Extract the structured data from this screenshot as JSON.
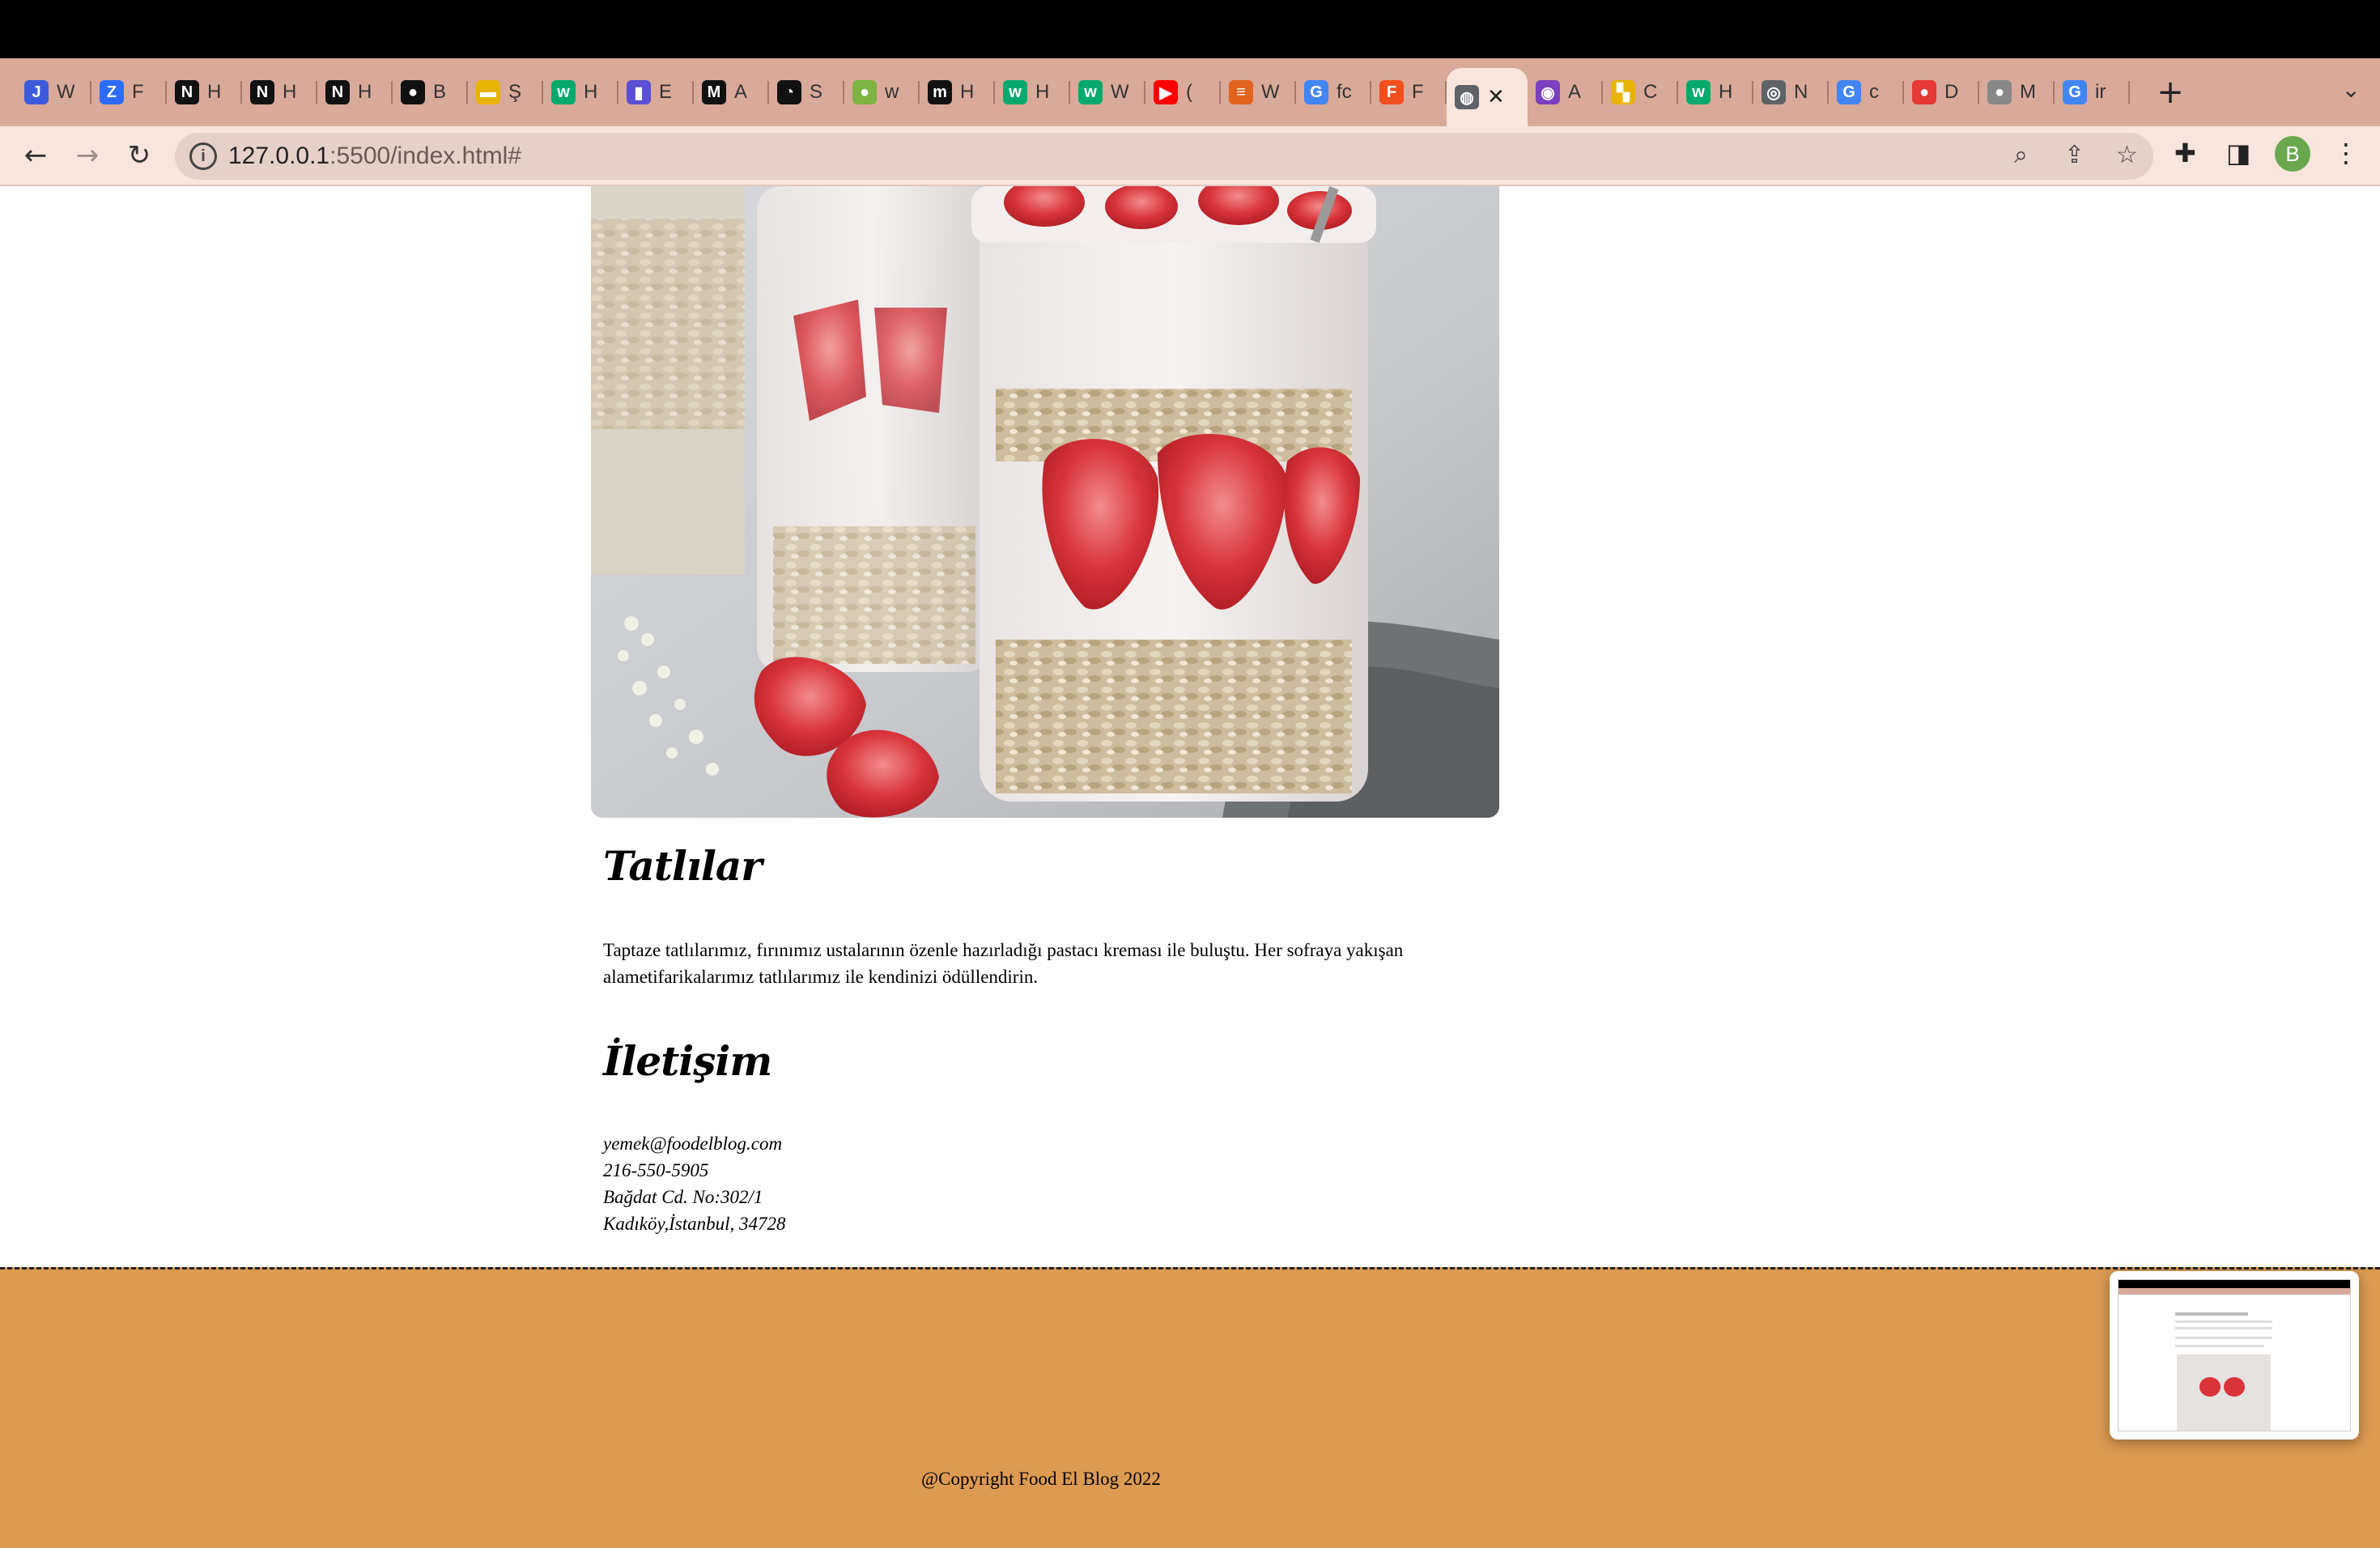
{
  "browser": {
    "tabs": [
      {
        "label": "W",
        "icon": "j-square-icon",
        "color": "#3b5bdb",
        "glyph": "J"
      },
      {
        "label": "F",
        "icon": "zoom-icon",
        "color": "#2d6bff",
        "glyph": "Z"
      },
      {
        "label": "H",
        "icon": "notion-icon",
        "color": "#111111",
        "glyph": "N"
      },
      {
        "label": "H",
        "icon": "notion-icon",
        "color": "#111111",
        "glyph": "N"
      },
      {
        "label": "H",
        "icon": "notion-icon",
        "color": "#111111",
        "glyph": "N"
      },
      {
        "label": "B",
        "icon": "github-icon",
        "color": "#111111",
        "glyph": "●"
      },
      {
        "label": "Ş",
        "icon": "ticket-icon",
        "color": "#e8b400",
        "glyph": "▬"
      },
      {
        "label": "H",
        "icon": "w3schools-icon",
        "color": "#04aa6d",
        "glyph": "w"
      },
      {
        "label": "E",
        "icon": "bookmark-icon",
        "color": "#5b4fd6",
        "glyph": "▮"
      },
      {
        "label": "A",
        "icon": "medium-icon",
        "color": "#111111",
        "glyph": "M"
      },
      {
        "label": "S",
        "icon": "speedometer-icon",
        "color": "#111111",
        "glyph": "◔"
      },
      {
        "label": "w",
        "icon": "droplet-icon",
        "color": "#7cb342",
        "glyph": "●"
      },
      {
        "label": "H",
        "icon": "m-icon",
        "color": "#111111",
        "glyph": "m"
      },
      {
        "label": "H",
        "icon": "w3schools-icon",
        "color": "#04aa6d",
        "glyph": "w"
      },
      {
        "label": "W",
        "icon": "w3schools-icon",
        "color": "#04aa6d",
        "glyph": "w"
      },
      {
        "label": "(",
        "icon": "youtube-icon",
        "color": "#ff0000",
        "glyph": "▶"
      },
      {
        "label": "W",
        "icon": "burger-icon",
        "color": "#e2631b",
        "glyph": "≡"
      },
      {
        "label": "fc",
        "icon": "google-icon",
        "color": "#4285f4",
        "glyph": "G"
      },
      {
        "label": "F",
        "icon": "figma-icon",
        "color": "#f24e1e",
        "glyph": "F"
      },
      {
        "label": "",
        "icon": "globe-icon",
        "color": "#5f6368",
        "glyph": "◍",
        "active": true
      },
      {
        "label": "A",
        "icon": "color-wheel-icon",
        "color": "#7b3fbf",
        "glyph": "◉"
      },
      {
        "label": "C",
        "icon": "coolors-icon",
        "color": "#e8b400",
        "glyph": "▚"
      },
      {
        "label": "H",
        "icon": "w3schools-icon",
        "color": "#04aa6d",
        "glyph": "w"
      },
      {
        "label": "N",
        "icon": "chrome-icon",
        "color": "#5f6368",
        "glyph": "◎"
      },
      {
        "label": "c",
        "icon": "google-icon",
        "color": "#4285f4",
        "glyph": "G"
      },
      {
        "label": "D",
        "icon": "red-circle-icon",
        "color": "#e53935",
        "glyph": "●"
      },
      {
        "label": "M",
        "icon": "apple-icon",
        "color": "#888888",
        "glyph": "●"
      },
      {
        "label": "ir",
        "icon": "google-icon",
        "color": "#4285f4",
        "glyph": "G"
      }
    ],
    "close_glyph": "✕",
    "new_tab_glyph": "+",
    "tab_search_glyph": "⌄",
    "url_host": "127.0.0.1",
    "url_path": ":5500/index.html#",
    "profile_initial": "B"
  },
  "page": {
    "section_desserts": {
      "heading": "Tatlılar",
      "text": "Taptaze tatlılarımız, fırınımız ustalarının özenle hazırladığı pastacı kreması ile buluştu. Her sofraya yakışan alametifarikalarımız tatlılarımız ile kendinizi ödüllendirin."
    },
    "section_contact": {
      "heading": "İletişim",
      "email": "yemek@foodelblog.com",
      "phone": "216-550-5905",
      "address_line1": "Bağdat Cd. No:302/1",
      "address_line2": "Kadıköy,İstanbul, 34728"
    },
    "footer": {
      "copyright": "@Copyright Food El Blog 2022"
    }
  },
  "colors": {
    "tabstrip": "#d9a99a",
    "toolbar": "#f8e5dd",
    "footer": "#dd9a52"
  }
}
